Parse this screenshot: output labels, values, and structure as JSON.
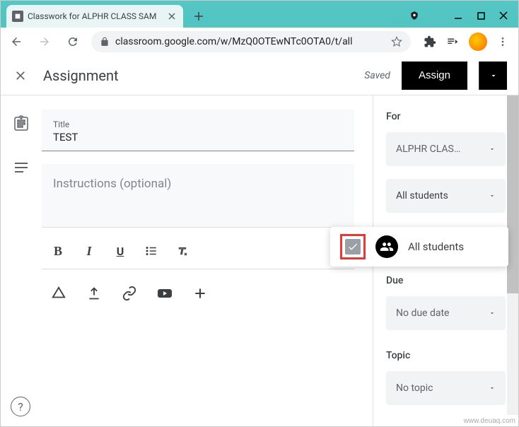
{
  "browser": {
    "tab_title": "Classwork for ALPHR CLASS SAM",
    "url": "classroom.google.com/w/MzQ0OTEwNTc0OTA0/t/all"
  },
  "header": {
    "title": "Assignment",
    "saved": "Saved",
    "assign": "Assign"
  },
  "editor": {
    "title_label": "Title",
    "title_value": "TEST",
    "instructions_placeholder": "Instructions (optional)"
  },
  "sidebar": {
    "for_label": "For",
    "class_selected": "ALPHR CLAS…",
    "students_selected": "All students",
    "due_label": "Due",
    "due_value": "No due date",
    "topic_label": "Topic",
    "topic_value": "No topic"
  },
  "popup": {
    "all_students": "All students"
  },
  "watermark": "www.deuaq.com"
}
